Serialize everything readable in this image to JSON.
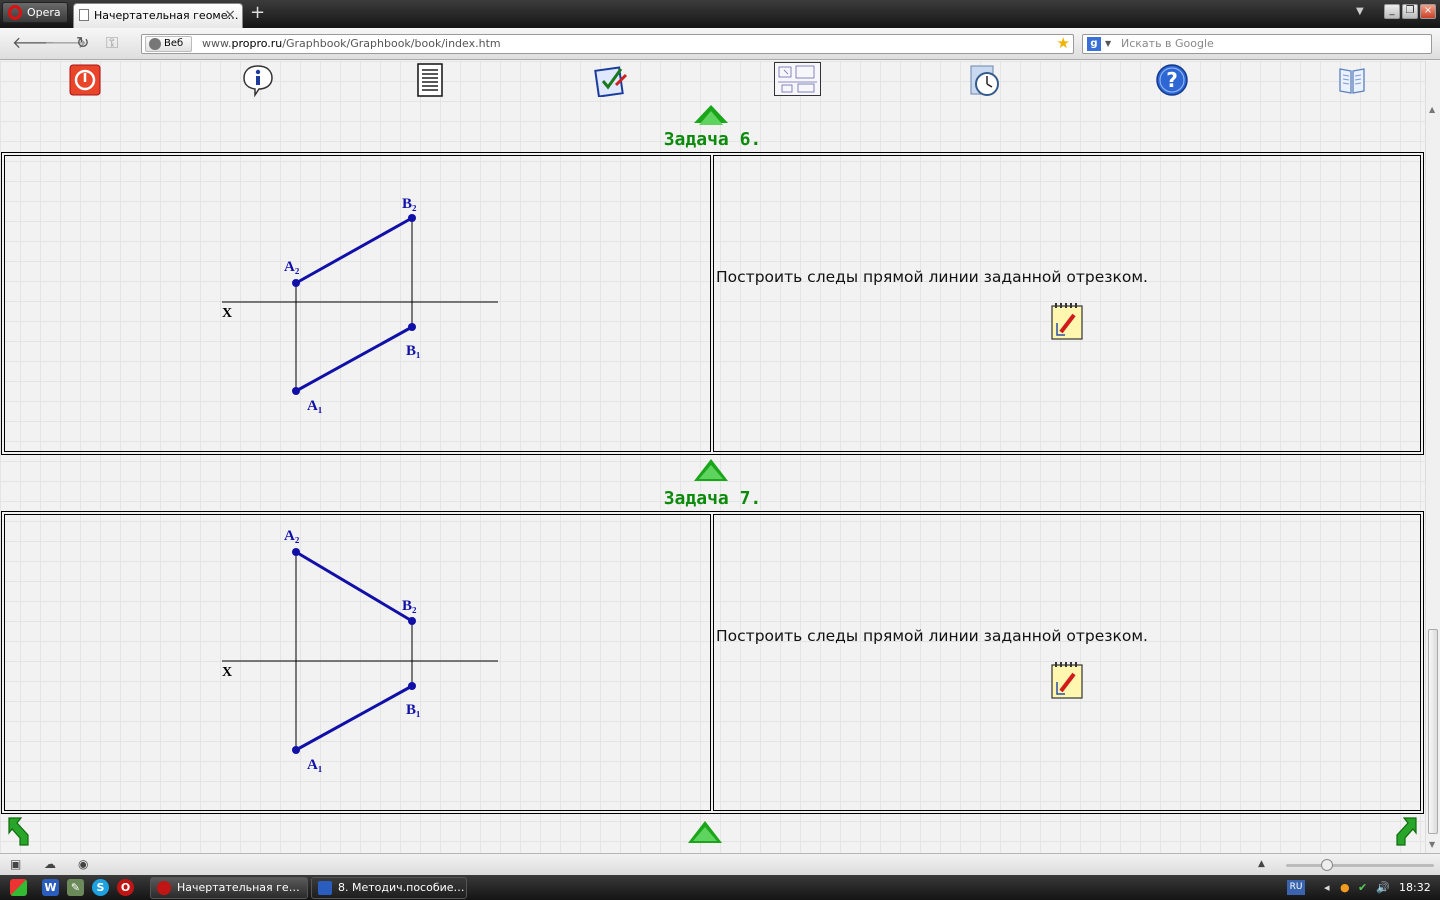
{
  "browser": {
    "menu_label": "Opera",
    "tab_title": "Начертательная геоме…",
    "tab_close": "×",
    "new_tab": "+",
    "tabs_menu": "▼",
    "win_min": "_",
    "win_max": "❐",
    "win_close": "×",
    "badge_label": "Веб",
    "url_prefix": "www.",
    "url_host": "propro.ru",
    "url_path": "/Graphbook/Graphbook/book/index.htm",
    "search_placeholder": "Искать в Google",
    "search_engine_icon": "google-icon"
  },
  "toolbar": {
    "icons": [
      "exit-icon",
      "info-icon",
      "document-icon",
      "test-icon",
      "drawing-icon",
      "timer-icon",
      "help-icon",
      "book-icon"
    ]
  },
  "tasks": [
    {
      "title": "Задача 6.",
      "text": "Построить следы прямой линии заданной отрезком.",
      "axis_label": "X",
      "labels": {
        "A2": "A₂",
        "B2": "B₂",
        "A1": "A₁",
        "B1": "B₁"
      }
    },
    {
      "title": "Задача 7.",
      "text": "Построить следы прямой линии заданной отрезком.",
      "axis_label": "X",
      "labels": {
        "A2": "A₂",
        "B2": "B₂",
        "A1": "A₁",
        "B1": "B₁"
      }
    }
  ],
  "colors": {
    "title_green": "#0b8a0b",
    "drawing_blue": "#1010a8",
    "arrow_green": "#1aa51a"
  },
  "taskbar": {
    "tasks": [
      "Начертательная ге…",
      "8. Методич.пособие…"
    ],
    "lang": "RU",
    "clock": "18:32"
  }
}
